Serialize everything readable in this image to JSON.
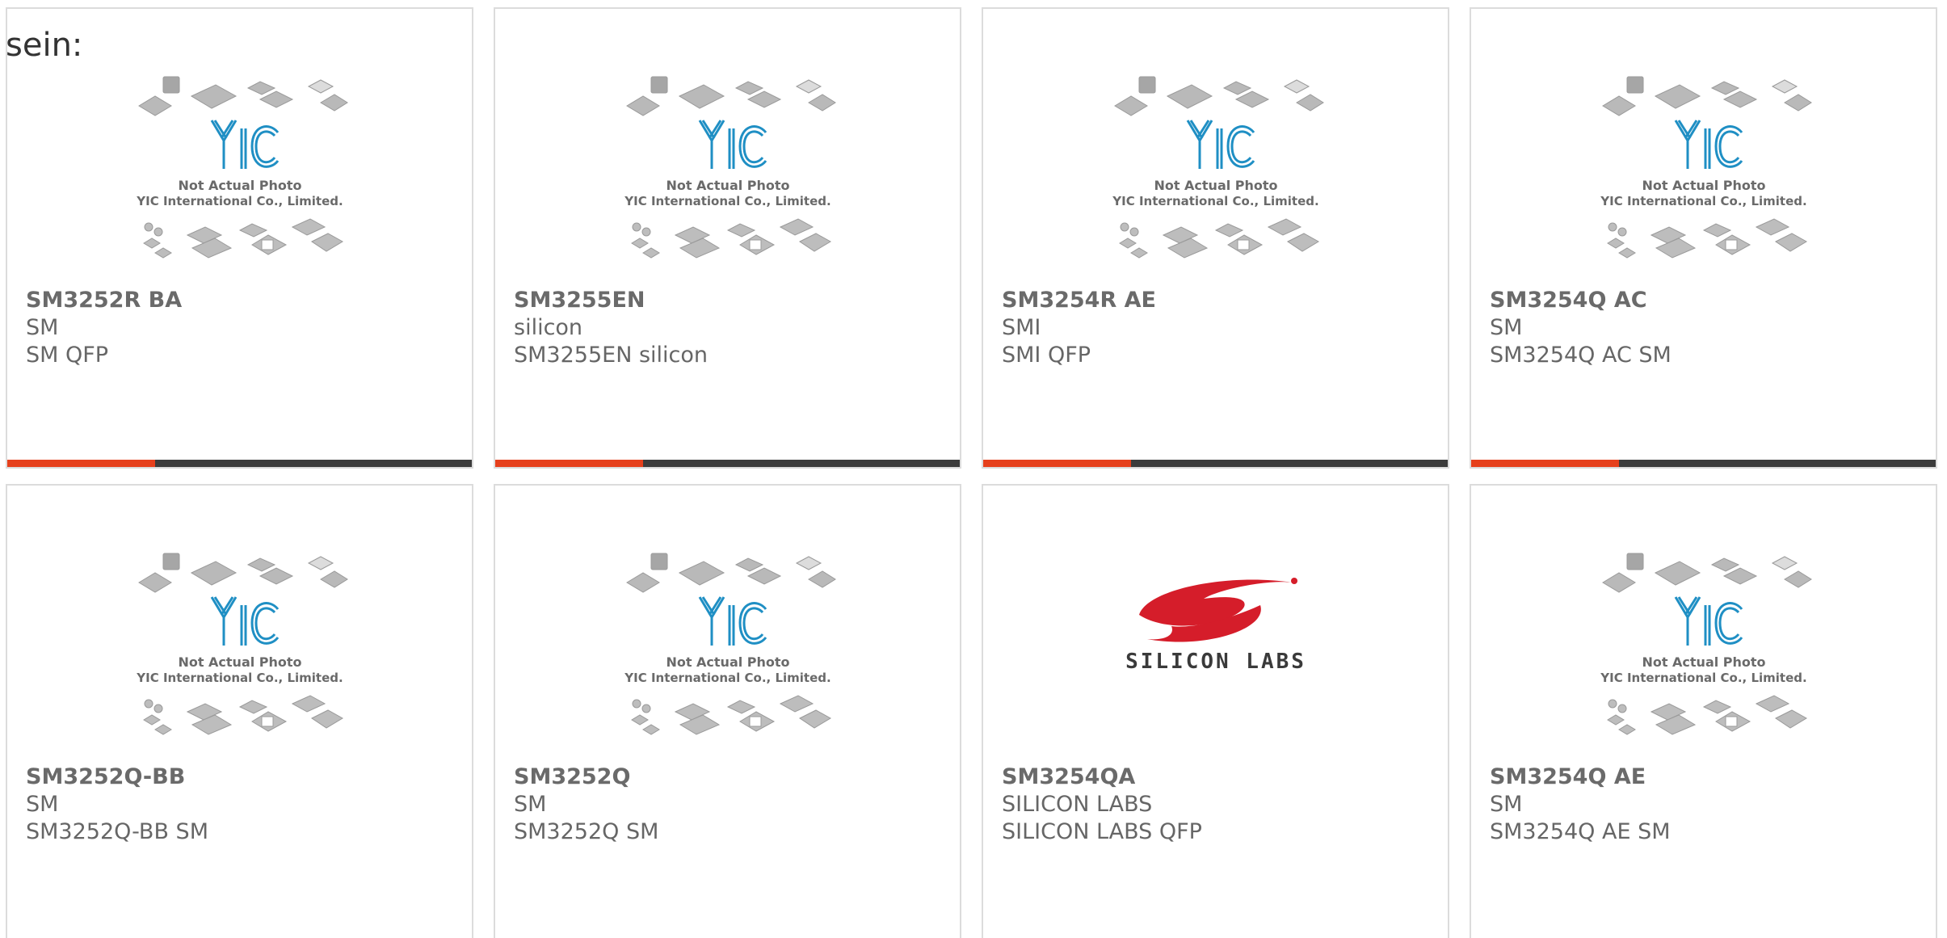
{
  "intro_text": "sein:",
  "colors": {
    "accent": "#e6401c",
    "bar": "#3c3c3c",
    "yic_blue": "#1f8fc4",
    "silicon_red": "#d51d2a"
  },
  "products": [
    {
      "part": "SM3252R BA",
      "maker": "SM",
      "desc": "SM QFP",
      "image": "yic-placeholder",
      "photo_text_1": "Not Actual Photo",
      "photo_text_2": "YIC International Co., Limited.",
      "logo_text": "YIC"
    },
    {
      "part": "SM3255EN",
      "maker": "silicon",
      "desc": "SM3255EN silicon",
      "image": "yic-placeholder",
      "photo_text_1": "Not Actual Photo",
      "photo_text_2": "YIC International Co., Limited.",
      "logo_text": "YIC"
    },
    {
      "part": "SM3254R AE",
      "maker": "SMI",
      "desc": "SMI QFP",
      "image": "yic-placeholder",
      "photo_text_1": "Not Actual Photo",
      "photo_text_2": "YIC International Co., Limited.",
      "logo_text": "YIC"
    },
    {
      "part": "SM3254Q AC",
      "maker": "SM",
      "desc": "SM3254Q AC SM",
      "image": "yic-placeholder",
      "photo_text_1": "Not Actual Photo",
      "photo_text_2": "YIC International Co., Limited.",
      "logo_text": "YIC"
    },
    {
      "part": "SM3252Q-BB",
      "maker": "SM",
      "desc": "SM3252Q-BB SM",
      "image": "yic-placeholder",
      "photo_text_1": "Not Actual Photo",
      "photo_text_2": "YIC International Co., Limited.",
      "logo_text": "YIC"
    },
    {
      "part": "SM3252Q",
      "maker": "SM",
      "desc": "SM3252Q SM",
      "image": "yic-placeholder",
      "photo_text_1": "Not Actual Photo",
      "photo_text_2": "YIC International Co., Limited.",
      "logo_text": "YIC"
    },
    {
      "part": "SM3254QA",
      "maker": "SILICON LABS",
      "desc": "SILICON LABS QFP",
      "image": "silicon-labs-logo",
      "logo_text": "SILICON LABS"
    },
    {
      "part": "SM3254Q AE",
      "maker": "SM",
      "desc": "SM3254Q AE SM",
      "image": "yic-placeholder",
      "photo_text_1": "Not Actual Photo",
      "photo_text_2": "YIC International Co., Limited.",
      "logo_text": "YIC"
    }
  ]
}
